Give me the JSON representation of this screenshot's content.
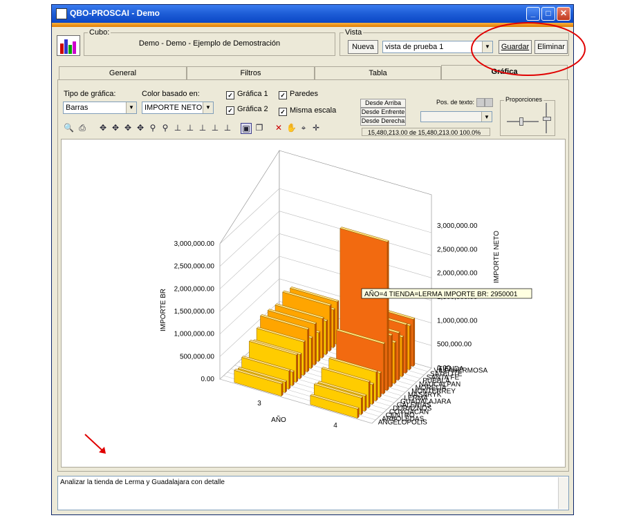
{
  "window": {
    "title": "QBO-PROSCAI - Demo"
  },
  "cubo": {
    "label": "Cubo:",
    "value": "Demo - Demo - Ejemplo de Demostración"
  },
  "vista": {
    "label": "Vista",
    "nueva": "Nueva",
    "selected": "vista de prueba 1",
    "guardar": "Guardar",
    "eliminar": "Eliminar"
  },
  "tabs": [
    "General",
    "Filtros",
    "Tabla",
    "Gráfica"
  ],
  "controls": {
    "tipo_label": "Tipo de gráfica:",
    "tipo_value": "Barras",
    "color_label": "Color basado en:",
    "color_value": "IMPORTE NETO",
    "grafica1": "Gráfica 1",
    "grafica2": "Gráfica 2",
    "paredes": "Paredes",
    "misma_escala": "Misma escala",
    "desde_arriba": "Desde Arriba",
    "desde_enfrente": "Desde Enfrente",
    "desde_derecha": "Desde Derecha",
    "pos_texto": "Pos. de texto:",
    "status": "15,480,213.00 de 15,480,213.00  100.0%",
    "proporciones": "Proporciones"
  },
  "chart_data": {
    "type": "bar",
    "z_axis_title": "TIENDA",
    "x_axis_title": "AÑO",
    "left_axis_title": "IMPORTE BR",
    "right_axis_title": "IMPORTE NETO",
    "x_categories": [
      "3",
      "4"
    ],
    "left_ticks": [
      "3,000,000.00",
      "2,500,000.00",
      "2,000,000.00",
      "1,500,000.00",
      "1,000,000.00",
      "500,000.00",
      "0.00"
    ],
    "right_ticks": [
      "3,000,000.00",
      "2,500,000.00",
      "2,000,000.00",
      "1,500,000.00",
      "1,000,000.00",
      "500,000.00",
      "0.00"
    ],
    "tiendas": [
      "ANGELOPOLIS",
      "ARBOLEDAS",
      "CENTRO",
      "COYOACAN",
      "DURAZNOS",
      "GALERIAS",
      "GUADALAJARA",
      "LERMA",
      "MASARYK",
      "MONTERREY",
      "MORELIA",
      "NAUCALPAN",
      "PUEBLA",
      "SANTA FE",
      "SATELITE",
      "VILLAHERMOSA"
    ],
    "tooltip": "AÑO=4    TIENDA=LERMA    IMPORTE BR: 2950001"
  },
  "memo": "Analizar la tienda de Lerma y Guadalajara con detalle",
  "colors": {
    "annotation": "#e00000",
    "bar_high": "#f26a10",
    "bar_low": "#ffcc00"
  }
}
